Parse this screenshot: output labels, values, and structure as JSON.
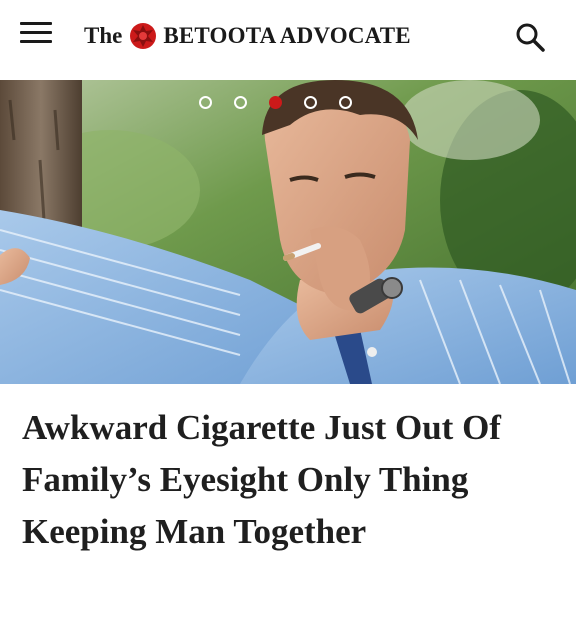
{
  "header": {
    "brand_prefix": "The",
    "brand_name": "BETOOTA ADVOCATE",
    "menu_icon": "hamburger-menu-icon",
    "search_icon": "search-icon",
    "logo_icon": "red-crest-logo",
    "accent_color": "#cc1a1a"
  },
  "carousel": {
    "slide_count": 5,
    "active_index": 2
  },
  "article": {
    "headline": "Awkward Cigarette Just Out Of Family’s Eyesight Only Thing Keeping Man Together"
  }
}
